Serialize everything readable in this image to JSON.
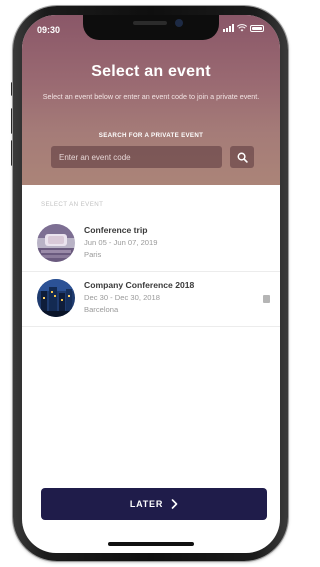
{
  "status_bar": {
    "time": "09:30"
  },
  "header": {
    "title": "Select an event",
    "subtitle": "Select an event below or enter an event code to join a private event.",
    "search_heading": "SEARCH FOR A PRIVATE EVENT",
    "search_placeholder": "Enter an event code",
    "search_icon": "search-icon"
  },
  "events_section": {
    "label": "SELECT AN EVENT",
    "items": [
      {
        "name": "Conference trip",
        "dates": "Jun 05 - Jun 07, 2019",
        "city": "Paris",
        "avatar_icon": "conference-room-thumbnail"
      },
      {
        "name": "Company Conference 2018",
        "dates": "Dec 30 - Dec 30, 2018",
        "city": "Barcelona",
        "avatar_icon": "city-night-thumbnail"
      }
    ]
  },
  "footer": {
    "later_label": "LATER",
    "later_icon": "chevron-right-icon"
  },
  "colors": {
    "header_gradient_top": "#8a5768",
    "header_gradient_bottom": "#ab8478",
    "primary_button": "#1f1c4a",
    "muted_text": "#9a9a9a"
  }
}
